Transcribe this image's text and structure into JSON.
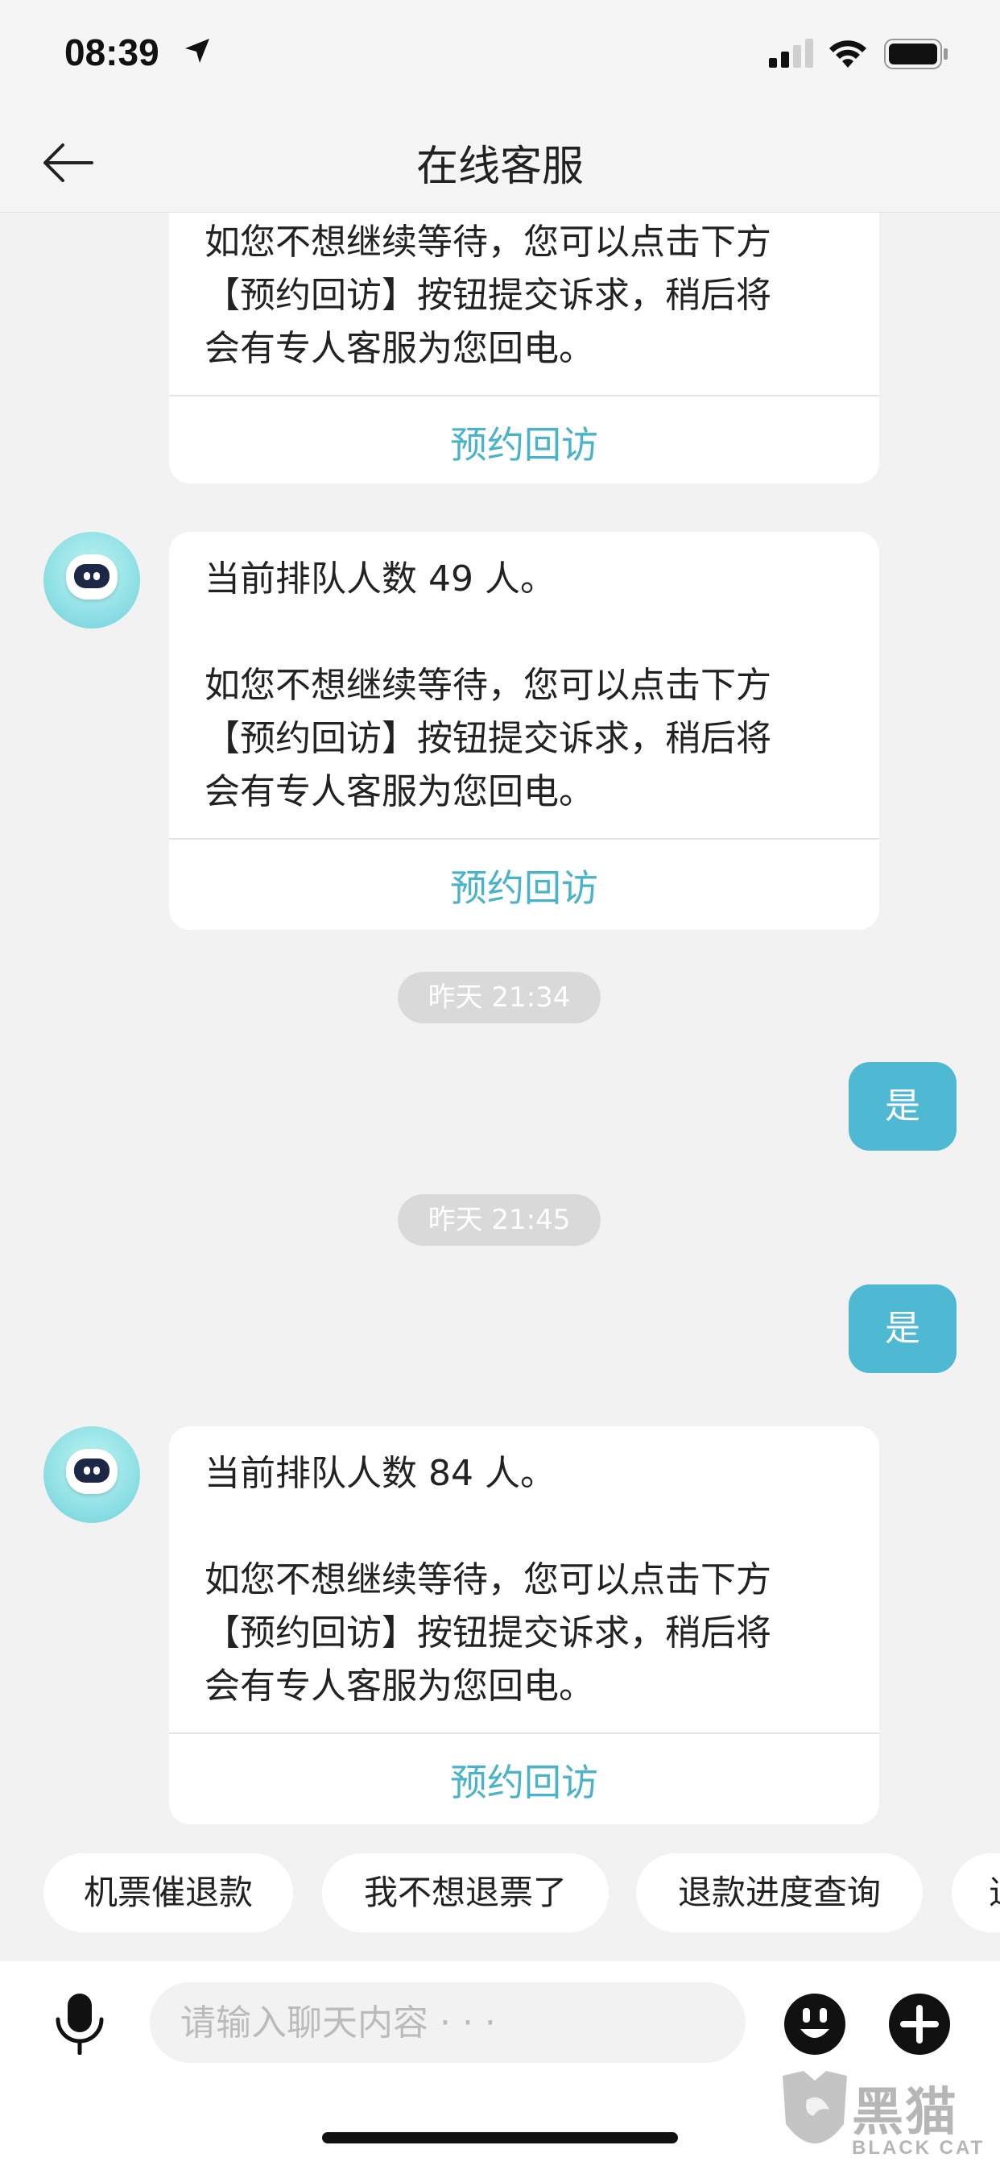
{
  "status_bar": {
    "time": "08:39"
  },
  "header": {
    "title": "在线客服"
  },
  "messages": {
    "partial_bot": {
      "lines": [
        "如您不想继续等待，您可以点击下方",
        "【预约回访】按钮提交诉求，稍后将",
        "会有专人客服为您回电。"
      ],
      "action": "预约回访"
    },
    "bot_1": {
      "queue": "当前排队人数 49 人。",
      "lines": [
        "如您不想继续等待，您可以点击下方",
        "【预约回访】按钮提交诉求，稍后将",
        "会有专人客服为您回电。"
      ],
      "action": "预约回访"
    },
    "timestamp_1": "昨天 21:34",
    "user_1": "是",
    "timestamp_2": "昨天 21:45",
    "user_2": "是",
    "bot_2": {
      "queue": "当前排队人数 84 人。",
      "lines": [
        "如您不想继续等待，您可以点击下方",
        "【预约回访】按钮提交诉求，稍后将",
        "会有专人客服为您回电。"
      ],
      "action": "预约回访"
    }
  },
  "quick_replies": [
    "机票催退款",
    "我不想退票了",
    "退款进度查询",
    "退"
  ],
  "input": {
    "placeholder": "请输入聊天内容 · · ·"
  },
  "watermark": {
    "cn": "黑猫",
    "en": "BLACK CAT"
  },
  "colors": {
    "accent": "#4fb8d2",
    "action_text": "#48b3c9",
    "background": "#f2f2f2"
  }
}
